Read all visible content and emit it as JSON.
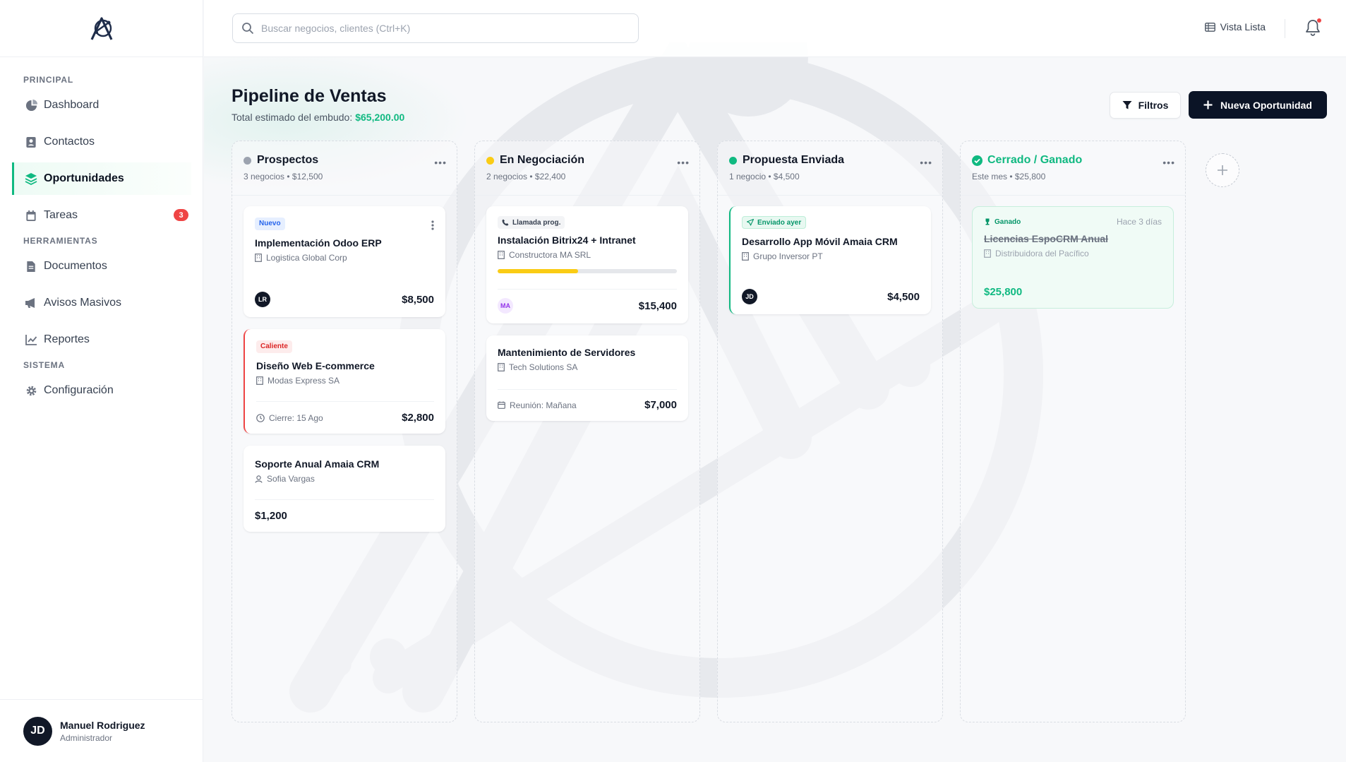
{
  "app": {
    "logo_icon": "amaia-logo"
  },
  "search": {
    "placeholder": "Buscar negocios, clientes (Ctrl+K)"
  },
  "topbar": {
    "view_label": "Vista Lista",
    "notifications_icon": "bell-icon"
  },
  "sidebar": {
    "sections": {
      "principal": "PRINCIPAL",
      "herramientas": "HERRAMIENTAS",
      "sistema": "SISTEMA"
    },
    "items": [
      {
        "label": "Dashboard",
        "icon": "pie-chart-icon"
      },
      {
        "label": "Contactos",
        "icon": "contact-card-icon"
      },
      {
        "label": "Oportunidades",
        "icon": "layers-icon",
        "active": true
      },
      {
        "label": "Tareas",
        "icon": "calendar-icon",
        "badge": "3"
      },
      {
        "label": "Documentos",
        "icon": "document-icon"
      },
      {
        "label": "Avisos Masivos",
        "icon": "megaphone-icon"
      },
      {
        "label": "Reportes",
        "icon": "line-chart-icon"
      },
      {
        "label": "Configuración",
        "icon": "gear-icon"
      }
    ]
  },
  "user": {
    "initials": "JD",
    "name": "Manuel Rodriguez",
    "role": "Administrador"
  },
  "header": {
    "title": "Pipeline de Ventas",
    "subtitle": "Total estimado del embudo:",
    "total": "$65,200.00",
    "filter_label": "Filtros",
    "new_label": "Nueva Oportunidad"
  },
  "columns": [
    {
      "title": "Prospectos",
      "summary": "3 negocios • $12,500",
      "color": "#9ca3af",
      "cards": [
        {
          "tag": "Nuevo",
          "title": "Implementación Odoo ERP",
          "company": "Logistica Global Corp",
          "avatar": "LR",
          "amount": "$8,500"
        },
        {
          "tag": "Caliente",
          "title": "Diseño Web E-commerce",
          "company": "Modas Express SA",
          "meta": "Cierre: 15 Ago",
          "amount": "$2,800"
        },
        {
          "title": "Soporte Anual Amaia CRM",
          "company": "Sofia Vargas",
          "amount": "$1,200"
        }
      ]
    },
    {
      "title": "En Negociación",
      "summary": "2 negocios • $22,400",
      "color": "#facc15",
      "cards": [
        {
          "tag": "Llamada prog.",
          "title": "Instalación Bitrix24 + Intranet",
          "company": "Constructora MA SRL",
          "progress": 0.45,
          "avatar": "MA",
          "amount": "$15,400"
        },
        {
          "title": "Mantenimiento de Servidores",
          "company": "Tech Solutions SA",
          "meta": "Reunión: Mañana",
          "amount": "$7,000"
        }
      ]
    },
    {
      "title": "Propuesta Enviada",
      "summary": "1 negocio • $4,500",
      "color": "#10b981",
      "cards": [
        {
          "tag": "Enviado ayer",
          "title": "Desarrollo App Móvil Amaia CRM",
          "company": "Grupo Inversor PT",
          "avatar": "JD",
          "amount": "$4,500"
        }
      ]
    },
    {
      "title": "Cerrado / Ganado",
      "summary": "Este mes • $25,800",
      "color": "#10b981",
      "cards": [
        {
          "tag": "Ganado",
          "time": "Hace 3 días",
          "title": "Licencias EspoCRM Anual",
          "company": "Distribuidora del Pacífico",
          "amount": "$25,800"
        }
      ]
    }
  ]
}
